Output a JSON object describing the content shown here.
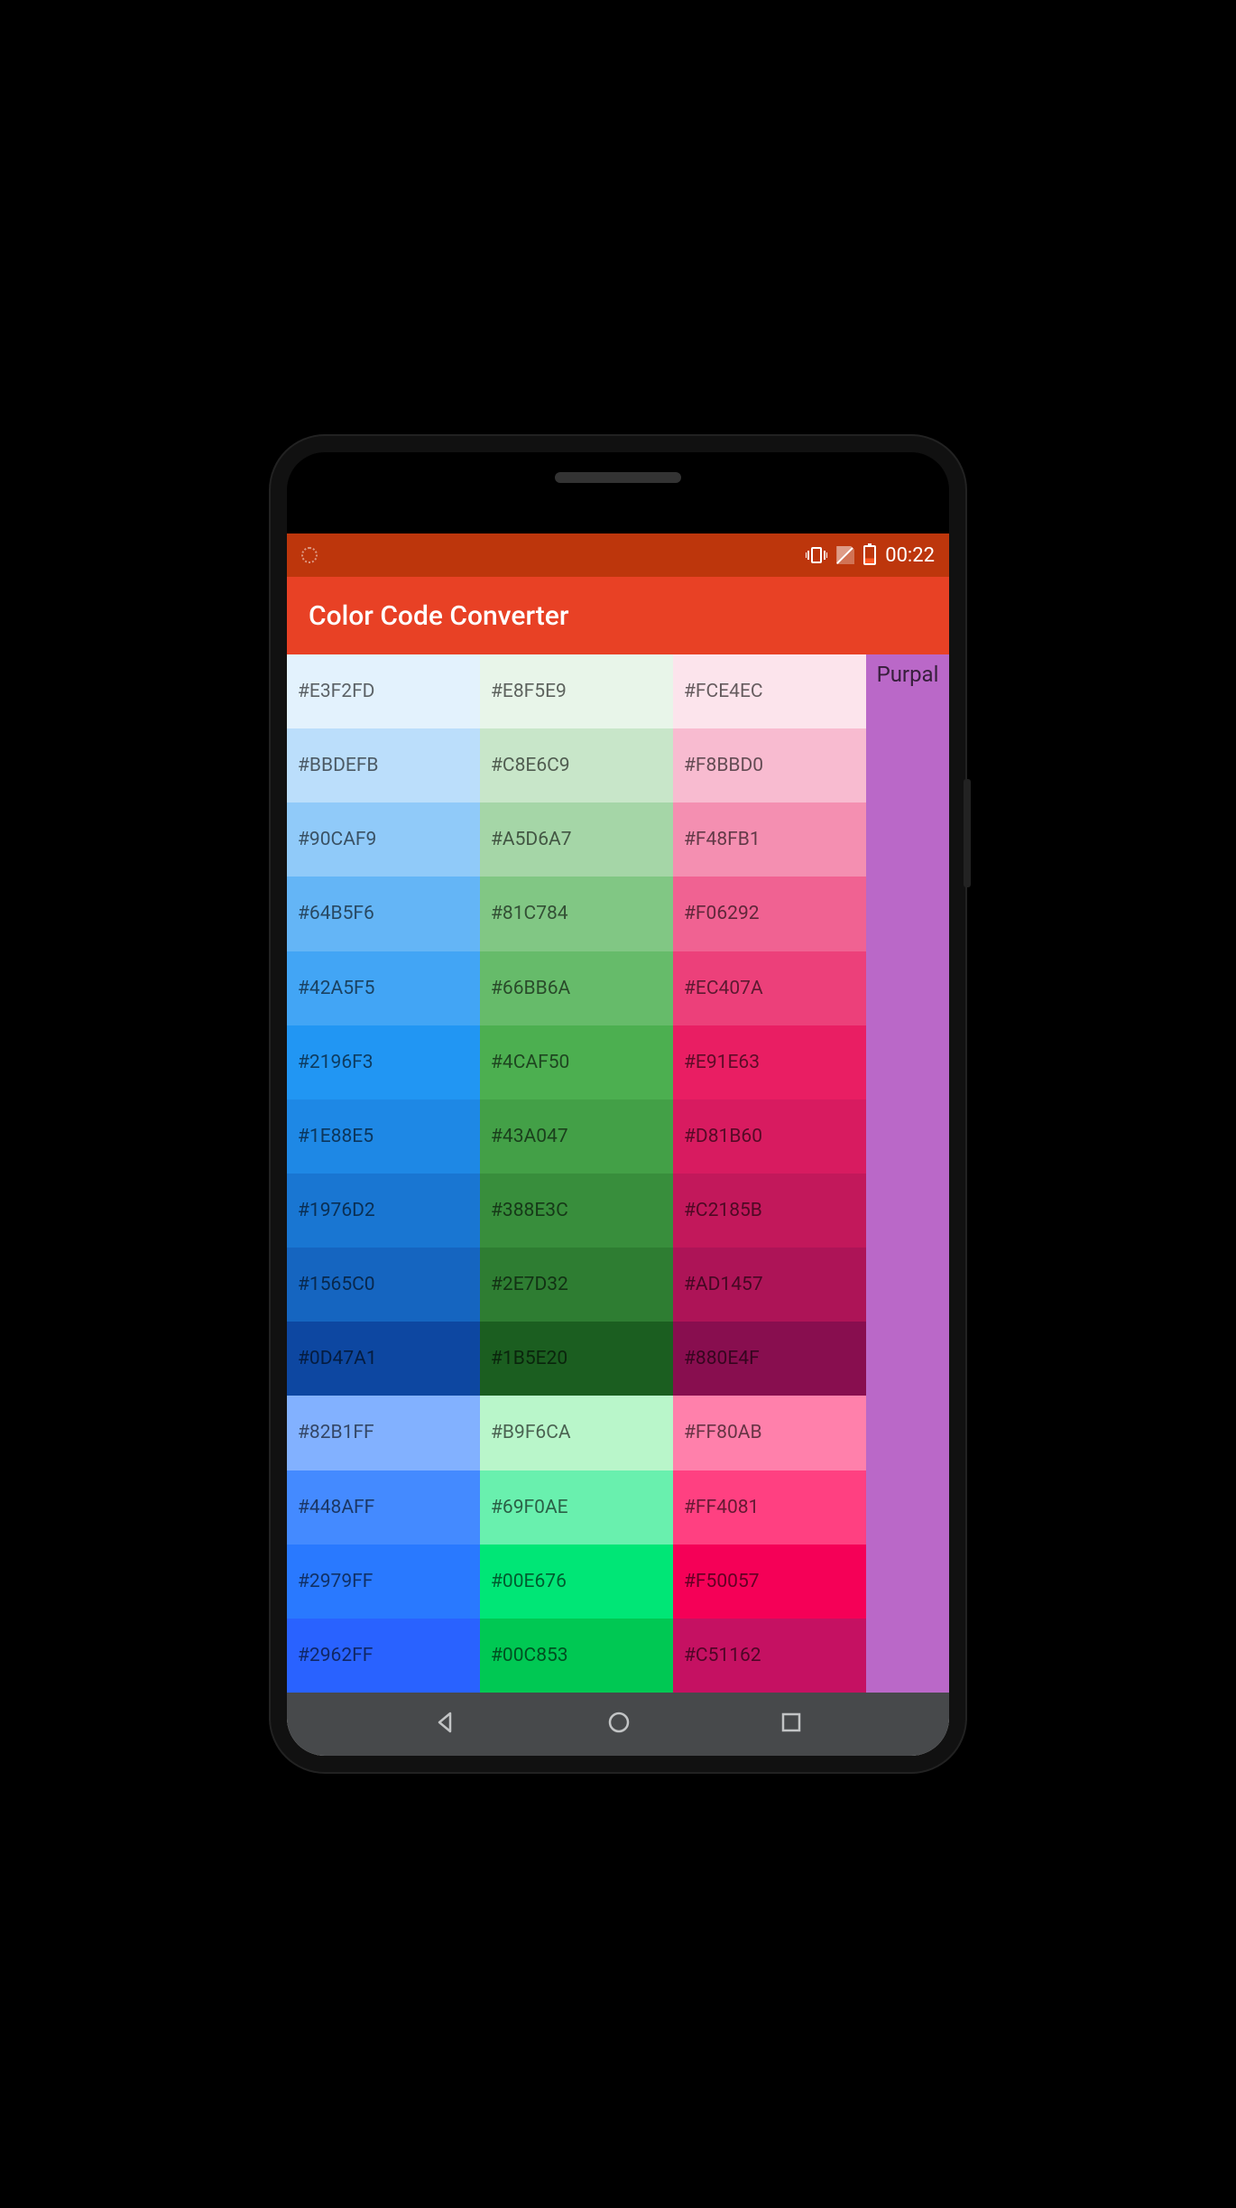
{
  "status": {
    "time": "00:22"
  },
  "appBar": {
    "title": "Color Code Converter"
  },
  "sideColumn": {
    "label": "Purpal",
    "color": "#BA68C8"
  },
  "columns": [
    [
      "#E3F2FD",
      "#BBDEFB",
      "#90CAF9",
      "#64B5F6",
      "#42A5F5",
      "#2196F3",
      "#1E88E5",
      "#1976D2",
      "#1565C0",
      "#0D47A1",
      "#82B1FF",
      "#448AFF",
      "#2979FF",
      "#2962FF"
    ],
    [
      "#E8F5E9",
      "#C8E6C9",
      "#A5D6A7",
      "#81C784",
      "#66BB6A",
      "#4CAF50",
      "#43A047",
      "#388E3C",
      "#2E7D32",
      "#1B5E20",
      "#B9F6CA",
      "#69F0AE",
      "#00E676",
      "#00C853"
    ],
    [
      "#FCE4EC",
      "#F8BBD0",
      "#F48FB1",
      "#F06292",
      "#EC407A",
      "#E91E63",
      "#D81B60",
      "#C2185B",
      "#AD1457",
      "#880E4F",
      "#FF80AB",
      "#FF4081",
      "#F50057",
      "#C51162"
    ]
  ]
}
